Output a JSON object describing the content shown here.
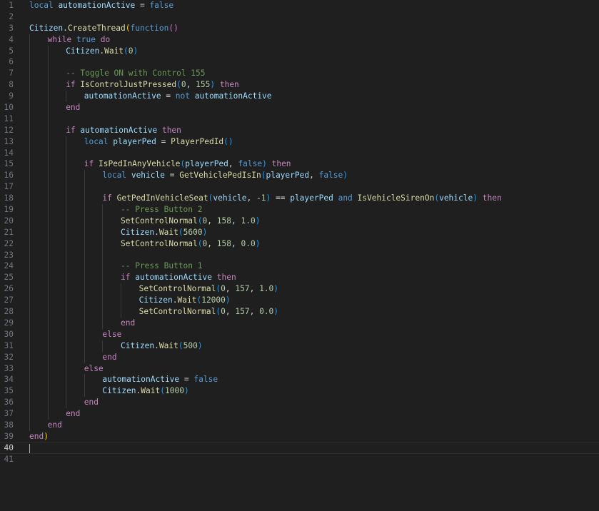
{
  "editor": {
    "language": "lua",
    "active_line": 40,
    "colors": {
      "background": "#1f1f1f",
      "line_number": "#6e7681",
      "keyword": "#569cd6",
      "control": "#c586c0",
      "variable": "#9cdcfe",
      "function": "#dcdcaa",
      "number": "#b5cea8",
      "comment": "#6a9955",
      "bracket_1": "#ffd700",
      "bracket_2": "#da70d6",
      "bracket_3": "#179fff"
    },
    "lines": [
      {
        "n": "1",
        "indent": 0,
        "tokens": [
          [
            "kw",
            "local"
          ],
          [
            "op",
            " "
          ],
          [
            "var",
            "automationActive"
          ],
          [
            "op",
            " = "
          ],
          [
            "kw",
            "false"
          ]
        ]
      },
      {
        "n": "2",
        "indent": 0,
        "tokens": []
      },
      {
        "n": "3",
        "indent": 0,
        "tokens": [
          [
            "var",
            "Citizen"
          ],
          [
            "op",
            "."
          ],
          [
            "fn",
            "CreateThread"
          ],
          [
            "p1",
            "("
          ],
          [
            "kw",
            "function"
          ],
          [
            "p2",
            "()"
          ]
        ]
      },
      {
        "n": "4",
        "indent": 1,
        "tokens": [
          [
            "ctl",
            "while"
          ],
          [
            "op",
            " "
          ],
          [
            "kw",
            "true"
          ],
          [
            "op",
            " "
          ],
          [
            "ctl",
            "do"
          ]
        ]
      },
      {
        "n": "5",
        "indent": 2,
        "tokens": [
          [
            "var",
            "Citizen"
          ],
          [
            "op",
            "."
          ],
          [
            "fn",
            "Wait"
          ],
          [
            "p3",
            "("
          ],
          [
            "num",
            "0"
          ],
          [
            "p3",
            ")"
          ]
        ]
      },
      {
        "n": "6",
        "indent": 2,
        "tokens": []
      },
      {
        "n": "7",
        "indent": 2,
        "tokens": [
          [
            "cm",
            "-- Toggle ON with Control 155"
          ]
        ]
      },
      {
        "n": "8",
        "indent": 2,
        "tokens": [
          [
            "ctl",
            "if"
          ],
          [
            "op",
            " "
          ],
          [
            "fn",
            "IsControlJustPressed"
          ],
          [
            "p3",
            "("
          ],
          [
            "num",
            "0"
          ],
          [
            "op",
            ", "
          ],
          [
            "num",
            "155"
          ],
          [
            "p3",
            ")"
          ],
          [
            "op",
            " "
          ],
          [
            "ctl",
            "then"
          ]
        ]
      },
      {
        "n": "9",
        "indent": 3,
        "tokens": [
          [
            "var",
            "automationActive"
          ],
          [
            "op",
            " = "
          ],
          [
            "kw",
            "not"
          ],
          [
            "op",
            " "
          ],
          [
            "var",
            "automationActive"
          ]
        ]
      },
      {
        "n": "10",
        "indent": 2,
        "tokens": [
          [
            "ctl",
            "end"
          ]
        ]
      },
      {
        "n": "11",
        "indent": 2,
        "tokens": []
      },
      {
        "n": "12",
        "indent": 2,
        "tokens": [
          [
            "ctl",
            "if"
          ],
          [
            "op",
            " "
          ],
          [
            "var",
            "automationActive"
          ],
          [
            "op",
            " "
          ],
          [
            "ctl",
            "then"
          ]
        ]
      },
      {
        "n": "13",
        "indent": 3,
        "tokens": [
          [
            "kw",
            "local"
          ],
          [
            "op",
            " "
          ],
          [
            "var",
            "playerPed"
          ],
          [
            "op",
            " = "
          ],
          [
            "fn",
            "PlayerPedId"
          ],
          [
            "p3",
            "()"
          ]
        ]
      },
      {
        "n": "14",
        "indent": 3,
        "tokens": []
      },
      {
        "n": "15",
        "indent": 3,
        "tokens": [
          [
            "ctl",
            "if"
          ],
          [
            "op",
            " "
          ],
          [
            "fn",
            "IsPedInAnyVehicle"
          ],
          [
            "p3",
            "("
          ],
          [
            "var",
            "playerPed"
          ],
          [
            "op",
            ", "
          ],
          [
            "kw",
            "false"
          ],
          [
            "p3",
            ")"
          ],
          [
            "op",
            " "
          ],
          [
            "ctl",
            "then"
          ]
        ]
      },
      {
        "n": "16",
        "indent": 4,
        "tokens": [
          [
            "kw",
            "local"
          ],
          [
            "op",
            " "
          ],
          [
            "var",
            "vehicle"
          ],
          [
            "op",
            " = "
          ],
          [
            "fn",
            "GetVehiclePedIsIn"
          ],
          [
            "p3",
            "("
          ],
          [
            "var",
            "playerPed"
          ],
          [
            "op",
            ", "
          ],
          [
            "kw",
            "false"
          ],
          [
            "p3",
            ")"
          ]
        ]
      },
      {
        "n": "17",
        "indent": 4,
        "tokens": []
      },
      {
        "n": "18",
        "indent": 4,
        "tokens": [
          [
            "ctl",
            "if"
          ],
          [
            "op",
            " "
          ],
          [
            "fn",
            "GetPedInVehicleSeat"
          ],
          [
            "p3",
            "("
          ],
          [
            "var",
            "vehicle"
          ],
          [
            "op",
            ", "
          ],
          [
            "op",
            "-"
          ],
          [
            "num",
            "1"
          ],
          [
            "p3",
            ")"
          ],
          [
            "op",
            " == "
          ],
          [
            "var",
            "playerPed"
          ],
          [
            "op",
            " "
          ],
          [
            "kw",
            "and"
          ],
          [
            "op",
            " "
          ],
          [
            "fn",
            "IsVehicleSirenOn"
          ],
          [
            "p3",
            "("
          ],
          [
            "var",
            "vehicle"
          ],
          [
            "p3",
            ")"
          ],
          [
            "op",
            " "
          ],
          [
            "ctl",
            "then"
          ]
        ]
      },
      {
        "n": "19",
        "indent": 5,
        "tokens": [
          [
            "cm",
            "-- Press Button 2"
          ]
        ]
      },
      {
        "n": "20",
        "indent": 5,
        "tokens": [
          [
            "fn",
            "SetControlNormal"
          ],
          [
            "p3",
            "("
          ],
          [
            "num",
            "0"
          ],
          [
            "op",
            ", "
          ],
          [
            "num",
            "158"
          ],
          [
            "op",
            ", "
          ],
          [
            "num",
            "1.0"
          ],
          [
            "p3",
            ")"
          ]
        ]
      },
      {
        "n": "21",
        "indent": 5,
        "tokens": [
          [
            "var",
            "Citizen"
          ],
          [
            "op",
            "."
          ],
          [
            "fn",
            "Wait"
          ],
          [
            "p3",
            "("
          ],
          [
            "num",
            "5600"
          ],
          [
            "p3",
            ")"
          ]
        ]
      },
      {
        "n": "22",
        "indent": 5,
        "tokens": [
          [
            "fn",
            "SetControlNormal"
          ],
          [
            "p3",
            "("
          ],
          [
            "num",
            "0"
          ],
          [
            "op",
            ", "
          ],
          [
            "num",
            "158"
          ],
          [
            "op",
            ", "
          ],
          [
            "num",
            "0.0"
          ],
          [
            "p3",
            ")"
          ]
        ]
      },
      {
        "n": "23",
        "indent": 5,
        "tokens": []
      },
      {
        "n": "24",
        "indent": 5,
        "tokens": [
          [
            "cm",
            "-- Press Button 1"
          ]
        ]
      },
      {
        "n": "25",
        "indent": 5,
        "tokens": [
          [
            "ctl",
            "if"
          ],
          [
            "op",
            " "
          ],
          [
            "var",
            "automationActive"
          ],
          [
            "op",
            " "
          ],
          [
            "ctl",
            "then"
          ]
        ]
      },
      {
        "n": "26",
        "indent": 6,
        "tokens": [
          [
            "fn",
            "SetControlNormal"
          ],
          [
            "p3",
            "("
          ],
          [
            "num",
            "0"
          ],
          [
            "op",
            ", "
          ],
          [
            "num",
            "157"
          ],
          [
            "op",
            ", "
          ],
          [
            "num",
            "1.0"
          ],
          [
            "p3",
            ")"
          ]
        ]
      },
      {
        "n": "27",
        "indent": 6,
        "tokens": [
          [
            "var",
            "Citizen"
          ],
          [
            "op",
            "."
          ],
          [
            "fn",
            "Wait"
          ],
          [
            "p3",
            "("
          ],
          [
            "num",
            "12000"
          ],
          [
            "p3",
            ")"
          ]
        ]
      },
      {
        "n": "28",
        "indent": 6,
        "tokens": [
          [
            "fn",
            "SetControlNormal"
          ],
          [
            "p3",
            "("
          ],
          [
            "num",
            "0"
          ],
          [
            "op",
            ", "
          ],
          [
            "num",
            "157"
          ],
          [
            "op",
            ", "
          ],
          [
            "num",
            "0.0"
          ],
          [
            "p3",
            ")"
          ]
        ]
      },
      {
        "n": "29",
        "indent": 5,
        "tokens": [
          [
            "ctl",
            "end"
          ]
        ]
      },
      {
        "n": "30",
        "indent": 4,
        "tokens": [
          [
            "ctl",
            "else"
          ]
        ]
      },
      {
        "n": "31",
        "indent": 5,
        "tokens": [
          [
            "var",
            "Citizen"
          ],
          [
            "op",
            "."
          ],
          [
            "fn",
            "Wait"
          ],
          [
            "p3",
            "("
          ],
          [
            "num",
            "500"
          ],
          [
            "p3",
            ")"
          ]
        ]
      },
      {
        "n": "32",
        "indent": 4,
        "tokens": [
          [
            "ctl",
            "end"
          ]
        ]
      },
      {
        "n": "33",
        "indent": 3,
        "tokens": [
          [
            "ctl",
            "else"
          ]
        ]
      },
      {
        "n": "34",
        "indent": 4,
        "tokens": [
          [
            "var",
            "automationActive"
          ],
          [
            "op",
            " = "
          ],
          [
            "kw",
            "false"
          ]
        ]
      },
      {
        "n": "35",
        "indent": 4,
        "tokens": [
          [
            "var",
            "Citizen"
          ],
          [
            "op",
            "."
          ],
          [
            "fn",
            "Wait"
          ],
          [
            "p3",
            "("
          ],
          [
            "num",
            "1000"
          ],
          [
            "p3",
            ")"
          ]
        ]
      },
      {
        "n": "36",
        "indent": 3,
        "tokens": [
          [
            "ctl",
            "end"
          ]
        ]
      },
      {
        "n": "37",
        "indent": 2,
        "tokens": [
          [
            "ctl",
            "end"
          ]
        ]
      },
      {
        "n": "38",
        "indent": 1,
        "tokens": [
          [
            "ctl",
            "end"
          ]
        ]
      },
      {
        "n": "39",
        "indent": 0,
        "tokens": [
          [
            "ctl",
            "end"
          ],
          [
            "p1",
            ")"
          ]
        ]
      },
      {
        "n": "40",
        "indent": 0,
        "tokens": []
      },
      {
        "n": "41",
        "indent": 0,
        "tokens": []
      }
    ]
  }
}
